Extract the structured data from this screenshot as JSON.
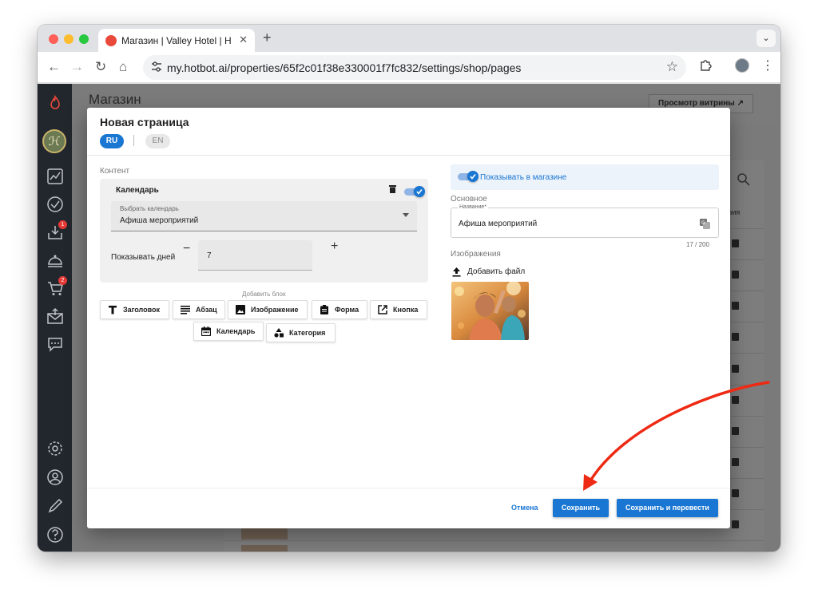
{
  "browser": {
    "tab_title": "Магазин | Valley Hotel | Hotbot",
    "tab_close": "✕",
    "new_tab": "+",
    "tab_menu": "⌄",
    "url": "my.hotbot.ai/properties/65f2c01f38e330001f7fc832/settings/shop/pages",
    "back": "←",
    "forward": "→",
    "reload": "↻",
    "home": "⌂",
    "star": "☆",
    "more": "⋮",
    "traffic_colors": [
      "#ff5f57",
      "#febc2e",
      "#28c840"
    ]
  },
  "sidebar": {
    "badges": {
      "inbox": "1",
      "cart": "2"
    },
    "avatar_glyph": "ℋ"
  },
  "background": {
    "title": "Магазин",
    "preview_button": "Просмотр витрины ↗",
    "actions_header": "ствия"
  },
  "modal": {
    "title": "Новая страница",
    "lang_ru": "RU",
    "lang_en": "EN",
    "content_label": "Контент",
    "calendar_block": {
      "title": "Календарь",
      "enabled": true,
      "select_label": "Выбрать календарь",
      "select_value": "Афиша мероприятий",
      "days_label": "Показывать дней",
      "days_value": "7",
      "minus": "−",
      "plus": "+"
    },
    "add_block_label": "Добавить блок",
    "add_blocks": {
      "heading": "Заголовок",
      "paragraph": "Абзац",
      "image": "Изображение",
      "form": "Форма",
      "button": "Кнопка",
      "calendar": "Календарь",
      "category": "Категория"
    },
    "show_in_shop": {
      "label": "Показывать в магазине",
      "enabled": true
    },
    "basic_label": "Основное",
    "name_field": {
      "label": "Название*",
      "value": "Афиша мероприятий",
      "counter": "17 / 200"
    },
    "images_label": "Изображения",
    "upload_label": "Добавить файл",
    "buttons": {
      "cancel": "Отмена",
      "save": "Сохранить",
      "save_translate": "Сохранить и перевести"
    }
  },
  "colors": {
    "primary": "#1976d2",
    "sidebar": "#22262d",
    "annotation_arrow": "#ee2a14"
  }
}
